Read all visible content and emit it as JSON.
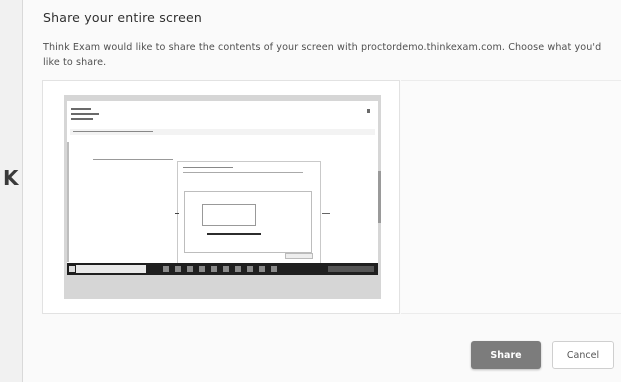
{
  "dialog": {
    "title": "Share your entire screen",
    "description": "Think Exam would like to share the contents of your screen with proctordemo.thinkexam.com. Choose what you'd like to share."
  },
  "background": {
    "partial_letter": "K"
  },
  "sources": [
    {
      "type": "entire-screen",
      "selected": true
    }
  ],
  "buttons": {
    "share": "Share",
    "cancel": "Cancel"
  },
  "colors": {
    "share_button": "#7c7c7c",
    "dialog_bg": "#fafafa",
    "page_bg": "#f1f1f1"
  }
}
